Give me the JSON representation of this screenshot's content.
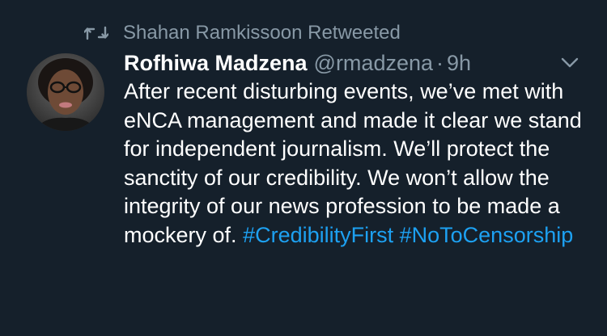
{
  "retweet": {
    "icon": "retweet-icon",
    "text": "Shahan Ramkissoon Retweeted"
  },
  "author": {
    "avatar": "avatar",
    "display_name": "Rofhiwa Madzena",
    "handle": "@rmadzena",
    "separator": "·",
    "time": "9h"
  },
  "menu": {
    "icon": "chevron-down-icon"
  },
  "tweet": {
    "text": "After recent disturbing events, we’ve met with eNCA management and made it clear we stand for independent journalism. We’ll protect the sanctity of our credibility. We won’t allow the integrity of our news profession to be made a mockery of.",
    "hashtags": [
      "#CredibilityFirst",
      "#NoToCensorship"
    ]
  },
  "colors": {
    "background": "#15202b",
    "text": "#ffffff",
    "muted": "#8899a6",
    "link": "#1da1f2"
  }
}
